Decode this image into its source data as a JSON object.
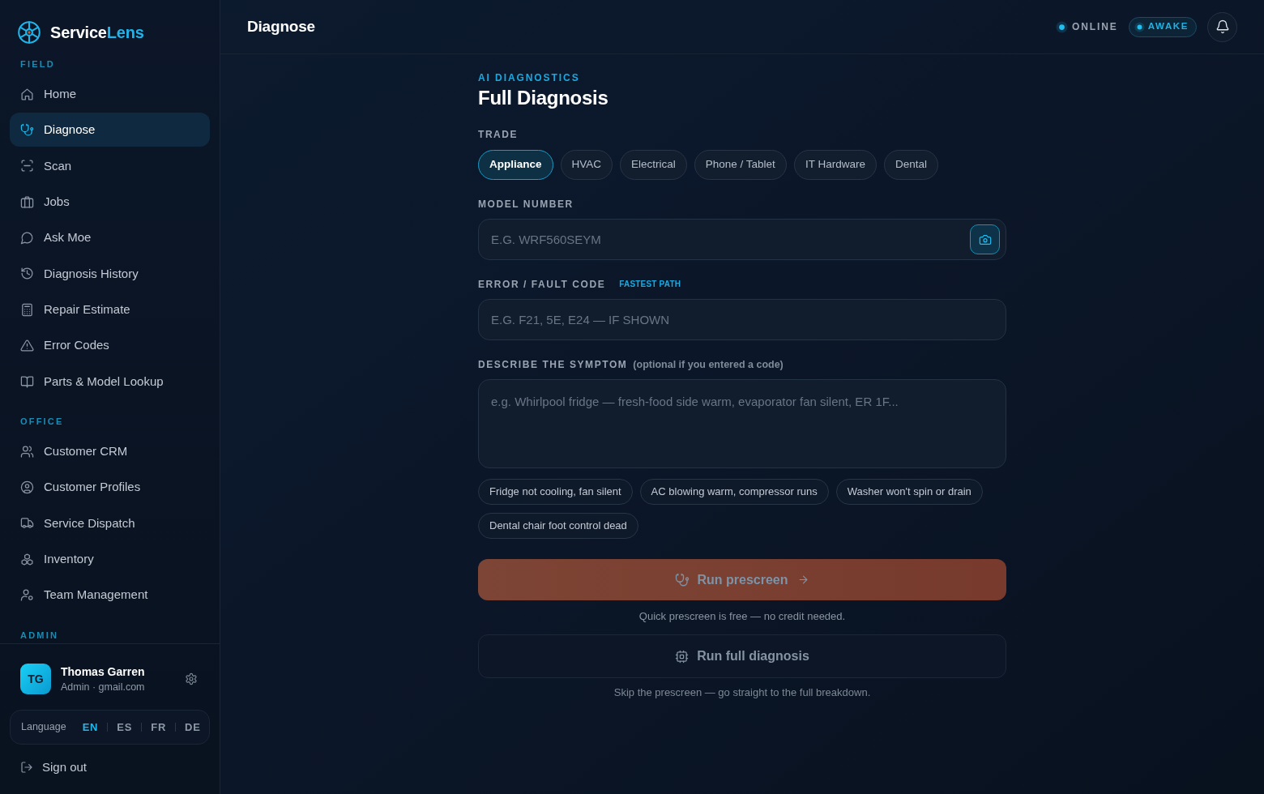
{
  "sidebar": {
    "brand": {
      "name": "Service",
      "name_accent": "Lens"
    },
    "sections": [
      {
        "title": "FIELD",
        "items": [
          {
            "label": "Home",
            "selected": false
          },
          {
            "label": "Diagnose",
            "selected": true
          },
          {
            "label": "Scan",
            "selected": false
          },
          {
            "label": "Jobs",
            "selected": false
          },
          {
            "label": "Ask Moe",
            "selected": false
          },
          {
            "label": "Diagnosis History",
            "selected": false
          },
          {
            "label": "Repair Estimate",
            "selected": false
          },
          {
            "label": "Error Codes",
            "selected": false
          },
          {
            "label": "Parts & Model Lookup",
            "selected": false
          }
        ]
      },
      {
        "title": "OFFICE",
        "items": [
          {
            "label": "Customer CRM",
            "selected": false
          },
          {
            "label": "Customer Profiles",
            "selected": false
          },
          {
            "label": "Service Dispatch",
            "selected": false
          },
          {
            "label": "Inventory",
            "selected": false
          },
          {
            "label": "Team Management",
            "selected": false
          }
        ]
      },
      {
        "title": "ADMIN"
      }
    ],
    "user": {
      "initials": "TG",
      "name": "Thomas Garren",
      "subtitle": "Admin · gmail.com"
    },
    "language": {
      "label": "Language",
      "options": [
        {
          "label": "EN",
          "selected": true
        },
        {
          "label": "ES",
          "selected": false
        },
        {
          "label": "FR",
          "selected": false
        },
        {
          "label": "DE",
          "selected": false
        }
      ]
    },
    "sign_out": "Sign out"
  },
  "header": {
    "title": "Diagnose",
    "status": [
      {
        "label": "ONLINE",
        "kind": "plain"
      },
      {
        "label": "AWAKE",
        "kind": "pill"
      }
    ]
  },
  "main": {
    "eyebrow": "AI DIAGNOSTICS",
    "title": "Full Diagnosis",
    "trade": {
      "label": "TRADE",
      "options": [
        {
          "label": "Appliance",
          "selected": true
        },
        {
          "label": "HVAC",
          "selected": false
        },
        {
          "label": "Electrical",
          "selected": false
        },
        {
          "label": "Phone / Tablet",
          "selected": false
        },
        {
          "label": "IT Hardware",
          "selected": false
        },
        {
          "label": "Dental",
          "selected": false
        }
      ]
    },
    "model_number": {
      "label": "MODEL NUMBER",
      "placeholder": "E.G. WRF560SEYM"
    },
    "fault_code": {
      "label": "ERROR / FAULT CODE",
      "tag": "FASTEST PATH",
      "placeholder": "E.G. F21, 5E, E24 — IF SHOWN"
    },
    "symptom": {
      "label": "DESCRIBE THE SYMPTOM",
      "hint": "(optional if you entered a code)",
      "placeholder": "e.g. Whirlpool fridge — fresh-food side warm, evaporator fan silent, ER 1F..."
    },
    "suggestions": [
      "Fridge not cooling, fan silent",
      "AC blowing warm, compressor runs",
      "Washer won't spin or drain",
      "Dental chair foot control dead"
    ],
    "prescreen_button": {
      "label": "Run prescreen",
      "disabled": true
    },
    "prescreen_note": "Quick prescreen is free — no credit needed.",
    "full_button": {
      "label": "Run full diagnosis",
      "disabled": true
    },
    "full_note": "Skip the prescreen — go straight to the full breakdown."
  }
}
